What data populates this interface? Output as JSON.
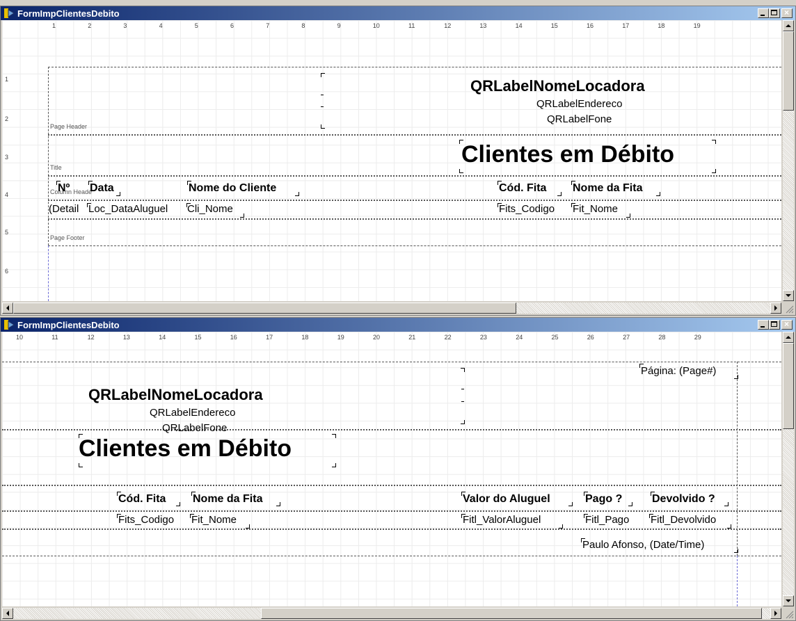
{
  "windows": [
    {
      "title": "FormImpClientesDebito",
      "ruler_top": [
        "1",
        "2",
        "3",
        "4",
        "5",
        "6",
        "7",
        "8",
        "9",
        "10",
        "11",
        "12",
        "13",
        "14",
        "15",
        "16",
        "17",
        "18",
        "19"
      ],
      "ruler_left": [
        "1",
        "2",
        "3",
        "4",
        "5",
        "6"
      ],
      "bands": {
        "page_header": "Page Header",
        "title": "Title",
        "column_header": "Column Header",
        "detail": "Detail",
        "page_footer": "Page Footer"
      },
      "labels": {
        "nome_locadora": "QRLabelNomeLocadora",
        "endereco": "QRLabelEndereco",
        "fone": "QRLabelFone",
        "titulo": "Clientes em Débito",
        "col_no": "Nº",
        "col_data": "Data",
        "col_nome_cliente": "Nome do Cliente",
        "col_cod_fita": "Cód. Fita",
        "col_nome_fita": "Nome da Fita",
        "fld_detail": "(Detail",
        "fld_loc_data": "Loc_DataAluguel",
        "fld_cli_nome": "Cli_Nome",
        "fld_fits_codigo": "Fits_Codigo",
        "fld_fit_nome": "Fit_Nome"
      }
    },
    {
      "title": "FormImpClientesDebito",
      "ruler_top": [
        "10",
        "11",
        "12",
        "13",
        "14",
        "15",
        "16",
        "17",
        "18",
        "19",
        "20",
        "21",
        "22",
        "23",
        "24",
        "25",
        "26",
        "27",
        "28",
        "29"
      ],
      "labels": {
        "nome_locadora": "QRLabelNomeLocadora",
        "endereco": "QRLabelEndereco",
        "fone": "QRLabelFone",
        "pagina": "Página: (Page#)",
        "titulo": "Clientes em Débito",
        "col_cod_fita": "Cód. Fita",
        "col_nome_fita": "Nome da Fita",
        "col_valor": "Valor do Aluguel",
        "col_pago": "Pago ?",
        "col_devolvido": "Devolvido ?",
        "fld_fits_codigo": "Fits_Codigo",
        "fld_fit_nome": "Fit_Nome",
        "fld_valor": "Fitl_ValorAluguel",
        "fld_pago": "Fitl_Pago",
        "fld_devolvido": "Fitl_Devolvido",
        "footer": "Paulo Afonso, (Date/Time)"
      }
    }
  ],
  "colors": {
    "titlebar_start": "#0a246a",
    "titlebar_end": "#a6caf0",
    "face": "#d4d0c8"
  }
}
